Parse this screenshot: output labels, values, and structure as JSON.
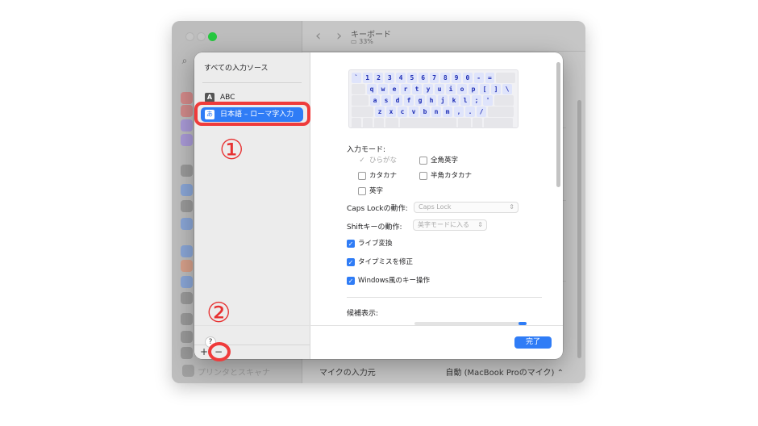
{
  "window": {
    "title": "キーボード",
    "battery": "33%",
    "nav_back": "‹",
    "nav_forward": "›",
    "sidebar_bottom_item": "プリンタとスキャナ",
    "mic_label": "マイクの入力元",
    "mic_value": "自動 (MacBook Proのマイク) ⌃"
  },
  "sources": {
    "header": "すべての入力ソース",
    "items": [
      {
        "badge": "A",
        "label": "ABC"
      },
      {
        "badge": "あ",
        "label": "日本語 – ローマ字入力"
      }
    ],
    "add_label": "+",
    "remove_label": "−"
  },
  "keyboard": {
    "rows": [
      [
        "`",
        "1",
        "2",
        "3",
        "4",
        "5",
        "6",
        "7",
        "8",
        "9",
        "0",
        "-",
        "="
      ],
      [
        "q",
        "w",
        "e",
        "r",
        "t",
        "y",
        "u",
        "i",
        "o",
        "p",
        "[",
        "]",
        "\\"
      ],
      [
        "a",
        "s",
        "d",
        "f",
        "g",
        "h",
        "j",
        "k",
        "l",
        ";",
        "'"
      ],
      [
        "z",
        "x",
        "c",
        "v",
        "b",
        "n",
        "m",
        ",",
        ".",
        "/"
      ]
    ]
  },
  "settings": {
    "input_mode_label": "入力モード:",
    "modes": {
      "hiragana": "ひらがな",
      "zenkaku_eiji": "全角英字",
      "katakana": "カタカナ",
      "hankaku_katakana": "半角カタカナ",
      "eiji": "英字"
    },
    "caps_lock_label": "Caps Lockの動作:",
    "caps_lock_value": "Caps Lock",
    "shift_label": "Shiftキーの動作:",
    "shift_value": "英字モードに入る",
    "live_conversion": "ライブ変換",
    "typo_fix": "タイプミスを修正",
    "windows_keys": "Windows風のキー操作",
    "candidates_label": "候補表示:"
  },
  "footer": {
    "help": "?",
    "done": "完了"
  },
  "annotations": {
    "one": "①",
    "two": "②"
  },
  "colors": {
    "accent": "#2f7cf6",
    "annotation": "#ef3b3b"
  }
}
